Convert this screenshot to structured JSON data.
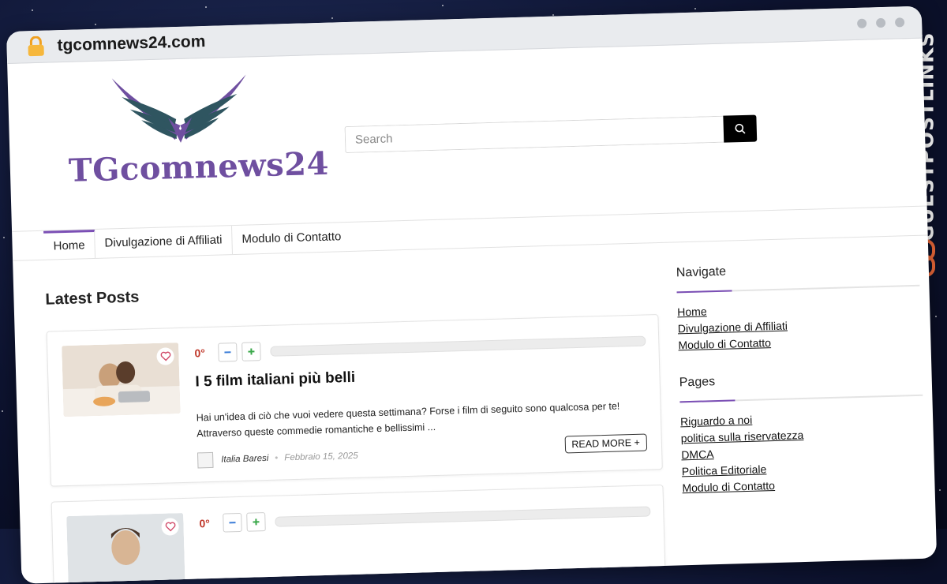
{
  "browser": {
    "url": "tgcomnews24.com"
  },
  "site": {
    "logo_text": "TGcomnews24",
    "brand_color": "#6f4fa0",
    "search_placeholder": "Search"
  },
  "nav": {
    "items": [
      {
        "label": "Home",
        "active": true
      },
      {
        "label": "Divulgazione di Affiliati",
        "active": false
      },
      {
        "label": "Modulo di Contatto",
        "active": false
      }
    ]
  },
  "main": {
    "section_title": "Latest Posts",
    "posts": [
      {
        "votes": "0°",
        "title": "I 5 film italiani più belli",
        "excerpt": "Hai un'idea di ciò che vuoi vedere questa settimana? Forse i film di seguito sono qualcosa per te! Attraverso queste commedie romantiche e bellissimi ...",
        "author": "Italia Baresi",
        "date": "Febbraio 15, 2025",
        "read_more": "READ MORE +"
      },
      {
        "votes": "0°"
      }
    ]
  },
  "sidebar": {
    "navigate": {
      "title": "Navigate",
      "links": [
        "Home",
        "Divulgazione di Affiliati",
        "Modulo di Contatto"
      ]
    },
    "pages": {
      "title": "Pages",
      "links": [
        "Riguardo a noi",
        "politica sulla riservatezza",
        "DMCA",
        "Politica Editoriale",
        "Modulo di Contatto"
      ]
    }
  },
  "watermark": {
    "text": "GUESTPOSTLINKS"
  },
  "colors": {
    "accent": "#7b4fb5",
    "vote_count": "#c0392b",
    "watermark_icon": "#f26b3a"
  }
}
